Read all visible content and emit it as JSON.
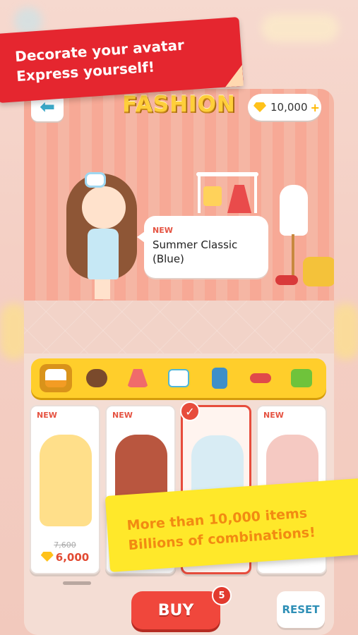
{
  "promo": {
    "top_line1": "Decorate your avatar",
    "top_line2": "Express yourself!",
    "bottom_line1": "More than 10,000 items",
    "bottom_line2": "Billions of combinations!"
  },
  "header": {
    "title": "FASHION",
    "back_icon": "arrow-left-icon",
    "gems": "10,000",
    "gem_icon": "diamond-icon",
    "plus": "+"
  },
  "preview": {
    "new_label": "NEW",
    "item_name": "Summer Classic (Blue)"
  },
  "categories": [
    {
      "icon": "outfit-icon",
      "active": true
    },
    {
      "icon": "hair-icon",
      "active": false
    },
    {
      "icon": "dress-icon",
      "active": false
    },
    {
      "icon": "top-icon",
      "active": false
    },
    {
      "icon": "pants-icon",
      "active": false
    },
    {
      "icon": "shoes-icon",
      "active": false
    },
    {
      "icon": "bag-icon",
      "active": false
    }
  ],
  "items": [
    {
      "badge": "NEW",
      "old_price": "7,600",
      "price": "6,000",
      "selected": false
    },
    {
      "badge": "NEW",
      "selected": false
    },
    {
      "badge": "",
      "selected": true
    },
    {
      "badge": "NEW",
      "selected": false
    }
  ],
  "actions": {
    "buy": "BUY",
    "buy_count": "5",
    "reset": "RESET"
  },
  "colors": {
    "accent_red": "#e5262f",
    "accent_yellow": "#ffe82a",
    "category_bar": "#ffce2b",
    "buy_button": "#f0473c"
  }
}
